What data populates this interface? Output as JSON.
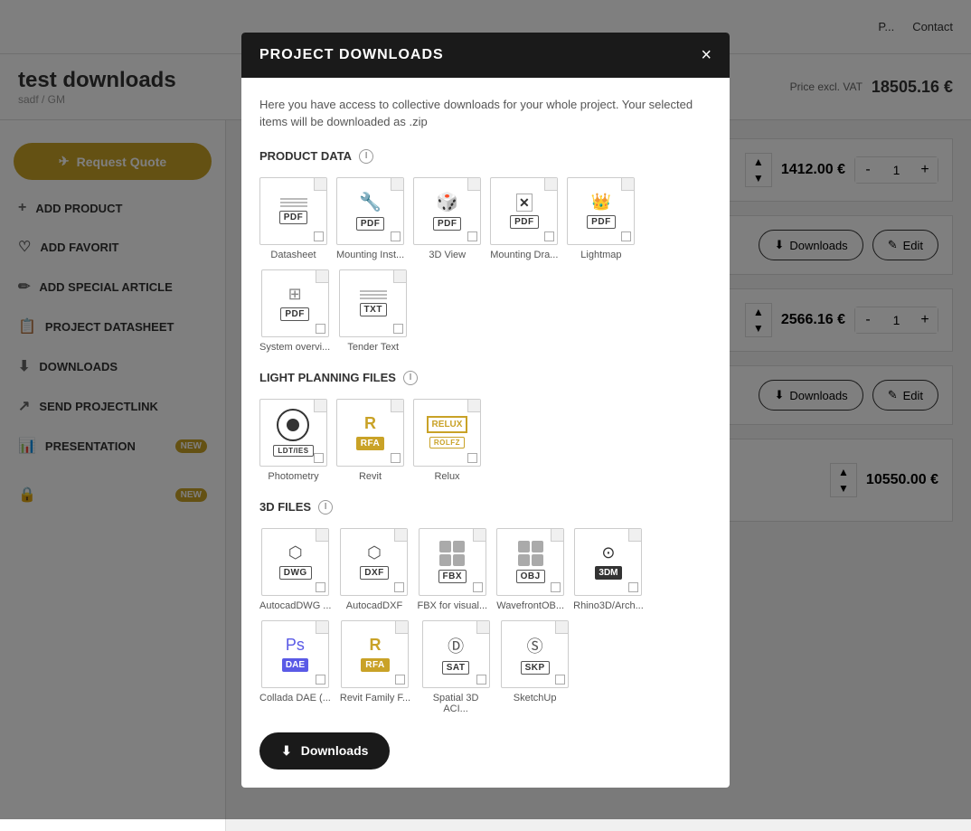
{
  "page": {
    "title": "test downloads",
    "subtitle": "sadf / GM",
    "price_label": "Price excl. VAT",
    "price_value": "18505.16 €"
  },
  "nav": {
    "links": [
      "P...",
      "Contact"
    ]
  },
  "sidebar": {
    "request_quote": "Request Quote",
    "items": [
      {
        "id": "add-product",
        "label": "ADD PRODUCT",
        "icon": "+"
      },
      {
        "id": "add-favorit",
        "label": "ADD FAVORIT",
        "icon": "♡"
      },
      {
        "id": "add-special-article",
        "label": "ADD SPECIAL ARTICLE",
        "icon": "✏"
      },
      {
        "id": "project-datasheet",
        "label": "PROJECT DATASHEET",
        "icon": "📋"
      },
      {
        "id": "downloads",
        "label": "DOWNLOADS",
        "icon": "⬇"
      },
      {
        "id": "send-projectlink",
        "label": "SEND PROJECTLINK",
        "icon": "↗"
      },
      {
        "id": "presentation",
        "label": "PRESENTATION",
        "icon": "📊",
        "badge": "NEW"
      }
    ]
  },
  "products": [
    {
      "price": "1412.00 €",
      "qty": "1"
    },
    {
      "price": "2566.16 €",
      "qty": "1"
    },
    {
      "price": "10550.00 €",
      "qty": ""
    }
  ],
  "modal": {
    "title": "PROJECT DOWNLOADS",
    "close_label": "×",
    "description": "Here you have access to collective downloads for your whole project. Your selected items will be downloaded as .zip",
    "sections": [
      {
        "id": "product-data",
        "title": "PRODUCT DATA",
        "has_info": true,
        "files": [
          {
            "id": "datasheet",
            "badge": "PDF",
            "label": "Datasheet",
            "type": "pdf"
          },
          {
            "id": "mounting-inst",
            "badge": "PDF",
            "label": "Mounting Inst...",
            "type": "pdf"
          },
          {
            "id": "3d-view",
            "badge": "PDF",
            "label": "3D View",
            "type": "pdf"
          },
          {
            "id": "mounting-dra",
            "badge": "PDF",
            "label": "Mounting Dra...",
            "type": "pdf"
          },
          {
            "id": "lightmap",
            "badge": "PDF",
            "label": "Lightmap",
            "type": "pdf"
          },
          {
            "id": "system-overvi",
            "badge": "PDF",
            "label": "System overvi...",
            "type": "pdf"
          },
          {
            "id": "tender-text",
            "badge": "TXT",
            "label": "Tender Text",
            "type": "txt"
          }
        ]
      },
      {
        "id": "light-planning",
        "title": "LIGHT PLANNING FILES",
        "has_info": true,
        "files": [
          {
            "id": "photometry",
            "badge": "LDT/IES",
            "label": "Photometry",
            "type": "ldt"
          },
          {
            "id": "revit",
            "badge": "RFA",
            "label": "Revit",
            "type": "rfa"
          },
          {
            "id": "relux",
            "badge": "ROLFZ",
            "label": "Relux",
            "type": "relux"
          }
        ]
      },
      {
        "id": "3d-files",
        "title": "3D FILES",
        "has_info": true,
        "files": [
          {
            "id": "autocad-dwg",
            "badge": "DWG",
            "label": "AutocadDWG ...",
            "type": "dwg"
          },
          {
            "id": "autocad-dxf",
            "badge": "DXF",
            "label": "AutocadDXF",
            "type": "dxf"
          },
          {
            "id": "fbx",
            "badge": "FBX",
            "label": "FBX for visual...",
            "type": "fbx"
          },
          {
            "id": "wavefront-obj",
            "badge": "OBJ",
            "label": "WavefrontOB...",
            "type": "obj"
          },
          {
            "id": "rhino3d",
            "badge": "3DM",
            "label": "Rhino3D/Arch...",
            "type": "threedm"
          },
          {
            "id": "collada-dae",
            "badge": "DAE",
            "label": "Collada DAE (...",
            "type": "dae"
          },
          {
            "id": "revit-family",
            "badge": "RFA",
            "label": "Revit Family F...",
            "type": "rfa2"
          },
          {
            "id": "spatial-3d",
            "badge": "SAT",
            "label": "Spatial 3D ACI...",
            "type": "sat"
          },
          {
            "id": "sketchup",
            "badge": "SKP",
            "label": "SketchUp",
            "type": "skp"
          }
        ]
      }
    ],
    "downloads_button": "Downloads"
  },
  "buttons": {
    "downloads_label": "Downloads",
    "edit_label": "Edit"
  },
  "icons": {
    "download": "⬇",
    "edit": "✎",
    "send": "✈",
    "close": "×"
  }
}
